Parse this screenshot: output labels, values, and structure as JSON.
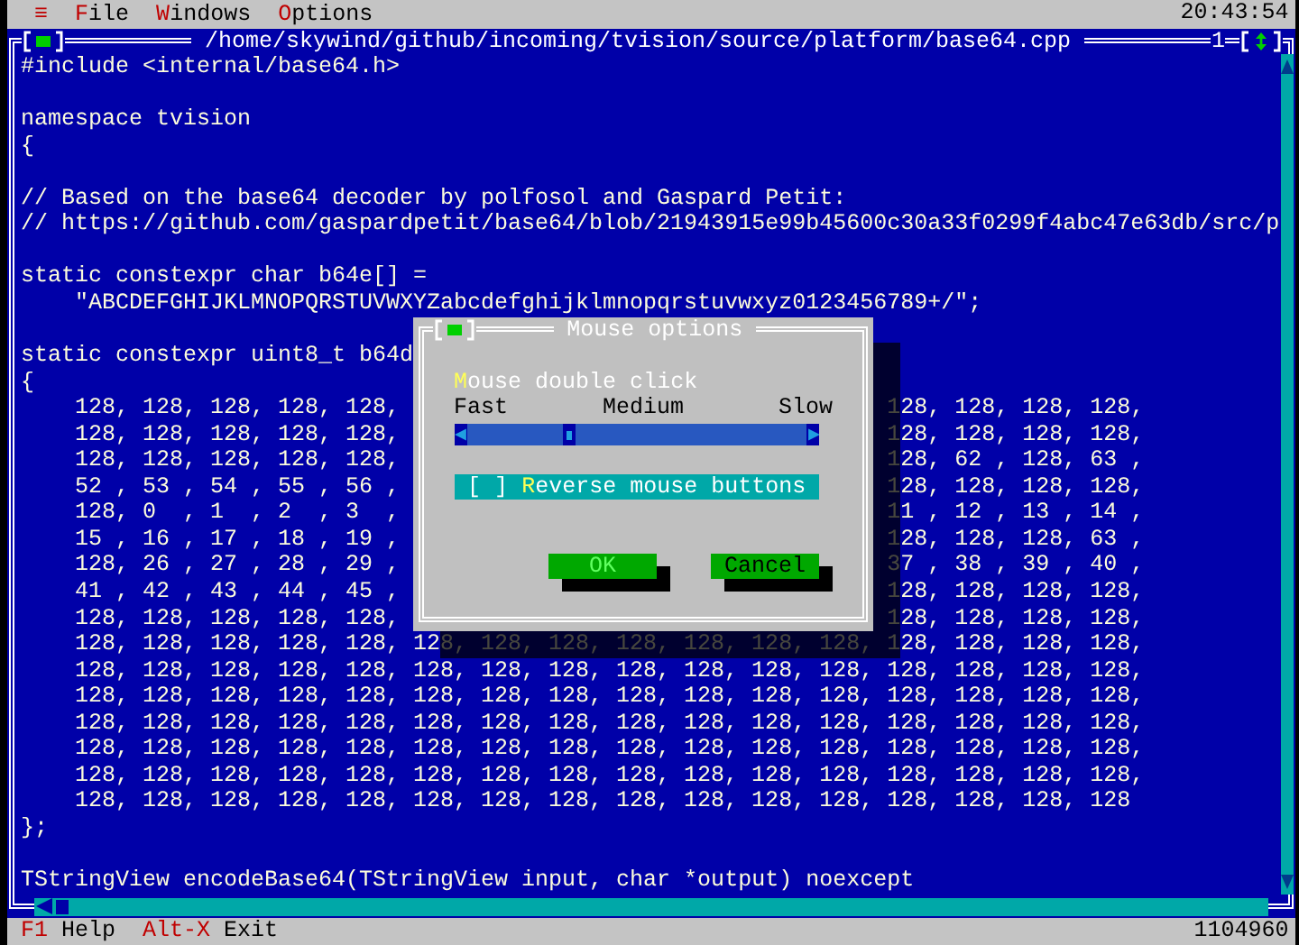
{
  "menu_bar": {
    "system_menu": "≡",
    "items": [
      {
        "hotkey": "F",
        "rest": "ile"
      },
      {
        "hotkey": "W",
        "rest": "indows"
      },
      {
        "hotkey": "O",
        "rest": "ptions"
      }
    ],
    "clock": "20:43:54"
  },
  "editor": {
    "title": "/home/skywind/github/incoming/tvision/source/platform/base64.cpp",
    "number": "1",
    "lines": [
      {
        "kind": "code",
        "indented": false,
        "text": "#include <internal/base64.h>"
      },
      {
        "kind": "blank"
      },
      {
        "kind": "code",
        "indented": false,
        "text": "namespace tvision"
      },
      {
        "kind": "code",
        "indented": false,
        "text": "{"
      },
      {
        "kind": "blank"
      },
      {
        "kind": "code",
        "indented": false,
        "text": "// Based on the base64 decoder by polfosol and Gaspard Petit:"
      },
      {
        "kind": "code",
        "indented": false,
        "text": "// https://github.com/gaspardpetit/base64/blob/21943915e99b45600c30a33f0299f4abc47e63db/src/p"
      },
      {
        "kind": "blank"
      },
      {
        "kind": "code",
        "indented": false,
        "text": "static constexpr char b64e[] ="
      },
      {
        "kind": "code",
        "indented": true,
        "text": "\"ABCDEFGHIJKLMNOPQRSTUVWXYZabcdefghijklmnopqrstuvwxyz0123456789+/\";"
      },
      {
        "kind": "blank"
      },
      {
        "kind": "code",
        "indented": false,
        "text": "static constexpr uint8_t b64d"
      },
      {
        "kind": "code",
        "indented": false,
        "text": "{"
      },
      {
        "kind": "split",
        "left": "128, 128, 128, 128, 128,",
        "right": "128, 128, 128, 128,"
      },
      {
        "kind": "split",
        "left": "128, 128, 128, 128, 128,",
        "right": "128, 128, 128, 128,"
      },
      {
        "kind": "split",
        "left": "128, 128, 128, 128, 128,",
        "right": "128, 62 , 128, 63 ,"
      },
      {
        "kind": "split",
        "left": "52 , 53 , 54 , 55 , 56 ,",
        "right": "128, 128, 128, 128,"
      },
      {
        "kind": "split",
        "left": "128, 0  , 1  , 2  , 3  ,",
        "right": "11 , 12 , 13 , 14 ,"
      },
      {
        "kind": "split",
        "left": "15 , 16 , 17 , 18 , 19 ,",
        "right": "128, 128, 128, 63 ,"
      },
      {
        "kind": "split",
        "left": "128, 26 , 27 , 28 , 29 ,",
        "right": "37 , 38 , 39 , 40 ,"
      },
      {
        "kind": "split",
        "left": "41 , 42 , 43 , 44 , 45 ,",
        "right": "128, 128, 128, 128,"
      },
      {
        "kind": "split",
        "left": "128, 128, 128, 128, 128,",
        "right": "128, 128, 128, 128,"
      },
      {
        "kind": "code",
        "indented": true,
        "text": "128, 128, 128, 128, 128, 128, 128, 128, 128, 128, 128, 128, 128, 128, 128, 128,"
      },
      {
        "kind": "code",
        "indented": true,
        "text": "128, 128, 128, 128, 128, 128, 128, 128, 128, 128, 128, 128, 128, 128, 128, 128,"
      },
      {
        "kind": "code",
        "indented": true,
        "text": "128, 128, 128, 128, 128, 128, 128, 128, 128, 128, 128, 128, 128, 128, 128, 128,"
      },
      {
        "kind": "code",
        "indented": true,
        "text": "128, 128, 128, 128, 128, 128, 128, 128, 128, 128, 128, 128, 128, 128, 128, 128,"
      },
      {
        "kind": "code",
        "indented": true,
        "text": "128, 128, 128, 128, 128, 128, 128, 128, 128, 128, 128, 128, 128, 128, 128, 128,"
      },
      {
        "kind": "code",
        "indented": true,
        "text": "128, 128, 128, 128, 128, 128, 128, 128, 128, 128, 128, 128, 128, 128, 128, 128,"
      },
      {
        "kind": "code",
        "indented": true,
        "text": "128, 128, 128, 128, 128, 128, 128, 128, 128, 128, 128, 128, 128, 128, 128, 128"
      },
      {
        "kind": "code",
        "indented": false,
        "text": "};"
      },
      {
        "kind": "blank"
      },
      {
        "kind": "code",
        "indented": false,
        "text": "TStringView encodeBase64(TStringView input, char *output) noexcept"
      }
    ]
  },
  "dialog": {
    "title": "Mouse options",
    "slider_label": {
      "hotkey": "M",
      "rest": "ouse double click"
    },
    "scale": [
      "Fast",
      "Medium",
      "Slow"
    ],
    "slider": {
      "level": 0.3
    },
    "checkbox": {
      "box": "[ ]",
      "hotkey": "R",
      "rest": "everse mouse buttons",
      "checked": false
    },
    "buttons": [
      {
        "label": "OK",
        "default": true
      },
      {
        "label": "Cancel",
        "default": false
      }
    ]
  },
  "status_bar": {
    "items": [
      {
        "key": "F1",
        "label": "Help"
      },
      {
        "key": "Alt-X",
        "label": "Exit"
      }
    ],
    "memory": "1104960"
  }
}
